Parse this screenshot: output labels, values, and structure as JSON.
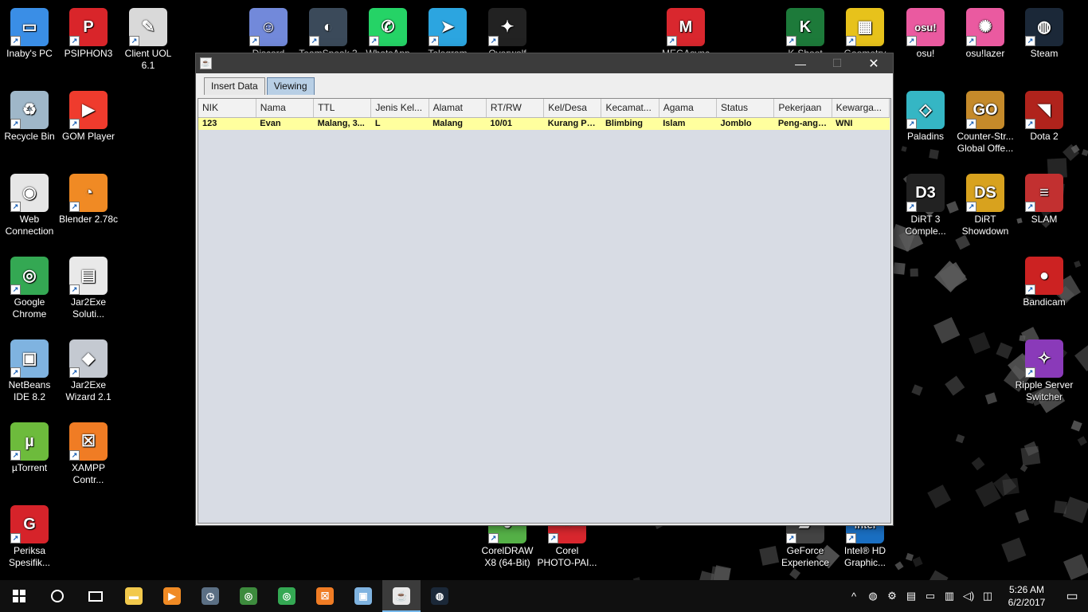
{
  "desktop": {
    "icons_left": [
      {
        "label": "Inaby's PC",
        "icon": "computer-icon",
        "color": "#3a8ee6",
        "glyph": "▭"
      },
      {
        "label": "PSIPHON3",
        "icon": "psiphon-icon",
        "color": "#d9252a",
        "glyph": "P"
      },
      {
        "label": "Client UOL 6.1",
        "icon": "uol-icon",
        "color": "#d9d9d9",
        "glyph": "✎"
      },
      {
        "label": "Recycle Bin",
        "icon": "recycle-bin-icon",
        "color": "#9fb7c9",
        "glyph": "♻"
      },
      {
        "label": "GOM Player",
        "icon": "gom-player-icon",
        "color": "#ef3b2d",
        "glyph": "▶"
      },
      {
        "label": "Web Connection",
        "icon": "wifi-icon",
        "color": "#e6e6e6",
        "glyph": "◉"
      },
      {
        "label": "Blender 2.78c",
        "icon": "blender-icon",
        "color": "#f08a24",
        "glyph": "◔"
      },
      {
        "label": "Google Chrome",
        "icon": "chrome-icon",
        "color": "#34a853",
        "glyph": "◎"
      },
      {
        "label": "Jar2Exe Soluti...",
        "icon": "jar2exe-icon",
        "color": "#e9e9e9",
        "glyph": "▤"
      },
      {
        "label": "NetBeans IDE 8.2",
        "icon": "netbeans-icon",
        "color": "#7fb3e0",
        "glyph": "▣"
      },
      {
        "label": "Jar2Exe Wizard 2.1",
        "icon": "jar2exe-wizard-icon",
        "color": "#c4c9d1",
        "glyph": "◆"
      },
      {
        "label": "µTorrent",
        "icon": "utorrent-icon",
        "color": "#6dbb3c",
        "glyph": "µ"
      },
      {
        "label": "XAMPP Contr...",
        "icon": "xampp-icon",
        "color": "#f07c24",
        "glyph": "☒"
      },
      {
        "label": "Periksa Spesifik...",
        "icon": "periksa-icon",
        "color": "#d6232a",
        "glyph": "G"
      }
    ],
    "icons_top": [
      {
        "label": "Discord",
        "icon": "discord-icon",
        "color": "#7289da",
        "glyph": "☺"
      },
      {
        "label": "TeamSpeak 3",
        "icon": "teamspeak-icon",
        "color": "#3b4a5a",
        "glyph": "◐"
      },
      {
        "label": "WhatsApp",
        "icon": "whatsapp-icon",
        "color": "#25d366",
        "glyph": "✆"
      },
      {
        "label": "Telegram",
        "icon": "telegram-icon",
        "color": "#2ca5e0",
        "glyph": "➤"
      },
      {
        "label": "Overwolf",
        "icon": "overwolf-icon",
        "color": "#222222",
        "glyph": "✦"
      },
      {
        "label": "MEGAsync",
        "icon": "mega-icon",
        "color": "#d9272e",
        "glyph": "M"
      },
      {
        "label": "K-Shoot",
        "icon": "kshoot-icon",
        "color": "#1d7a3a",
        "glyph": "K"
      },
      {
        "label": "Geometry",
        "icon": "geometry-dash-icon",
        "color": "#e7c21b",
        "glyph": "▦"
      }
    ],
    "icons_right": [
      {
        "label": "osu!",
        "icon": "osu-icon",
        "color": "#ea5aa0",
        "glyph": "osu!"
      },
      {
        "label": "osu!lazer",
        "icon": "osu-lazer-icon",
        "color": "#ea5aa0",
        "glyph": "✺"
      },
      {
        "label": "Steam",
        "icon": "steam-icon",
        "color": "#1b2838",
        "glyph": "◍"
      },
      {
        "label": "Paladins",
        "icon": "paladins-icon",
        "color": "#35b6c4",
        "glyph": "◇"
      },
      {
        "label": "Counter-Str... Global Offe...",
        "icon": "csgo-icon",
        "color": "#c58a2a",
        "glyph": "GO"
      },
      {
        "label": "Dota 2",
        "icon": "dota2-icon",
        "color": "#b0231c",
        "glyph": "◥"
      },
      {
        "label": "DiRT 3 Comple...",
        "icon": "dirt3-icon",
        "color": "#222222",
        "glyph": "D3"
      },
      {
        "label": "DiRT Showdown",
        "icon": "dirt-showdown-icon",
        "color": "#d8a21e",
        "glyph": "DS"
      },
      {
        "label": "SLAM",
        "icon": "slam-icon",
        "color": "#c23030",
        "glyph": "≡"
      },
      {
        "label": "Bandicam",
        "icon": "bandicam-icon",
        "color": "#cc2222",
        "glyph": "●"
      },
      {
        "label": "Ripple Server Switcher",
        "icon": "ripple-icon",
        "color": "#8a3ab9",
        "glyph": "✧"
      }
    ],
    "icons_bottom": [
      {
        "label": "CorelDRAW X8 (64-Bit)",
        "icon": "coreldraw-icon",
        "color": "#55b147",
        "glyph": "◒"
      },
      {
        "label": "Corel PHOTO-PAI...",
        "icon": "corel-photopaint-icon",
        "color": "#d9272e",
        "glyph": "◓"
      },
      {
        "label": "GeForce Experience",
        "icon": "geforce-icon",
        "color": "#444444",
        "glyph": "▰"
      },
      {
        "label": "Intel® HD Graphic...",
        "icon": "intel-icon",
        "color": "#1a6fc2",
        "glyph": "intel"
      }
    ]
  },
  "window": {
    "title": "",
    "tabs": [
      {
        "label": "Insert Data",
        "active": false
      },
      {
        "label": "Viewing",
        "active": true
      }
    ],
    "table": {
      "columns": [
        "NIK",
        "Nama",
        "TTL",
        "Jenis Kel...",
        "Alamat",
        "RT/RW",
        "Kel/Desa",
        "Kecamat...",
        "Agama",
        "Status",
        "Pekerjaan",
        "Kewarga..."
      ],
      "rows": [
        [
          "123",
          "Evan",
          "Malang, 3...",
          "L",
          "Malang",
          "10/01",
          "Kurang Pa...",
          "Blimbing",
          "Islam",
          "Jomblo",
          "Peng-angg...",
          "WNI"
        ]
      ]
    }
  },
  "taskbar": {
    "clock_time": "5:26 AM",
    "clock_date": "6/2/2017",
    "pinned": [
      {
        "name": "file-explorer-icon",
        "color": "#f2c94c",
        "glyph": "▬"
      },
      {
        "name": "media-player-icon",
        "color": "#f08a24",
        "glyph": "▶"
      },
      {
        "name": "clock-app-icon",
        "color": "#5b6f84",
        "glyph": "◷"
      },
      {
        "name": "network-app-icon",
        "color": "#3d8b3d",
        "glyph": "◎"
      },
      {
        "name": "chrome-icon",
        "color": "#34a853",
        "glyph": "◎"
      },
      {
        "name": "xampp-icon",
        "color": "#f07c24",
        "glyph": "☒"
      },
      {
        "name": "netbeans-icon",
        "color": "#7fb3e0",
        "glyph": "▣"
      },
      {
        "name": "java-icon",
        "color": "#e8e8e8",
        "glyph": "☕",
        "active": true
      },
      {
        "name": "steam-icon",
        "color": "#1b2838",
        "glyph": "◍"
      }
    ]
  }
}
